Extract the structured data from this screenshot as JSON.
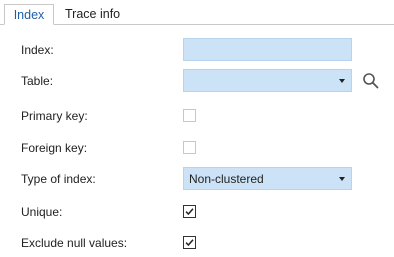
{
  "tabs": [
    {
      "label": "Index",
      "active": true
    },
    {
      "label": "Trace info",
      "active": false
    }
  ],
  "form": {
    "index": {
      "label": "Index:",
      "value": ""
    },
    "table": {
      "label": "Table:",
      "value": ""
    },
    "primary_key": {
      "label": "Primary key:",
      "checked": false,
      "enabled": false
    },
    "foreign_key": {
      "label": "Foreign key:",
      "checked": false,
      "enabled": false
    },
    "type_of_index": {
      "label": "Type of index:",
      "value": "Non-clustered"
    },
    "unique": {
      "label": "Unique:",
      "checked": true
    },
    "exclude_null": {
      "label": "Exclude null values:",
      "checked": true
    }
  },
  "icons": {
    "lookup": "search-icon"
  },
  "colors": {
    "field_bg": "#cce3f7",
    "active_tab_text": "#1f5fa8"
  }
}
